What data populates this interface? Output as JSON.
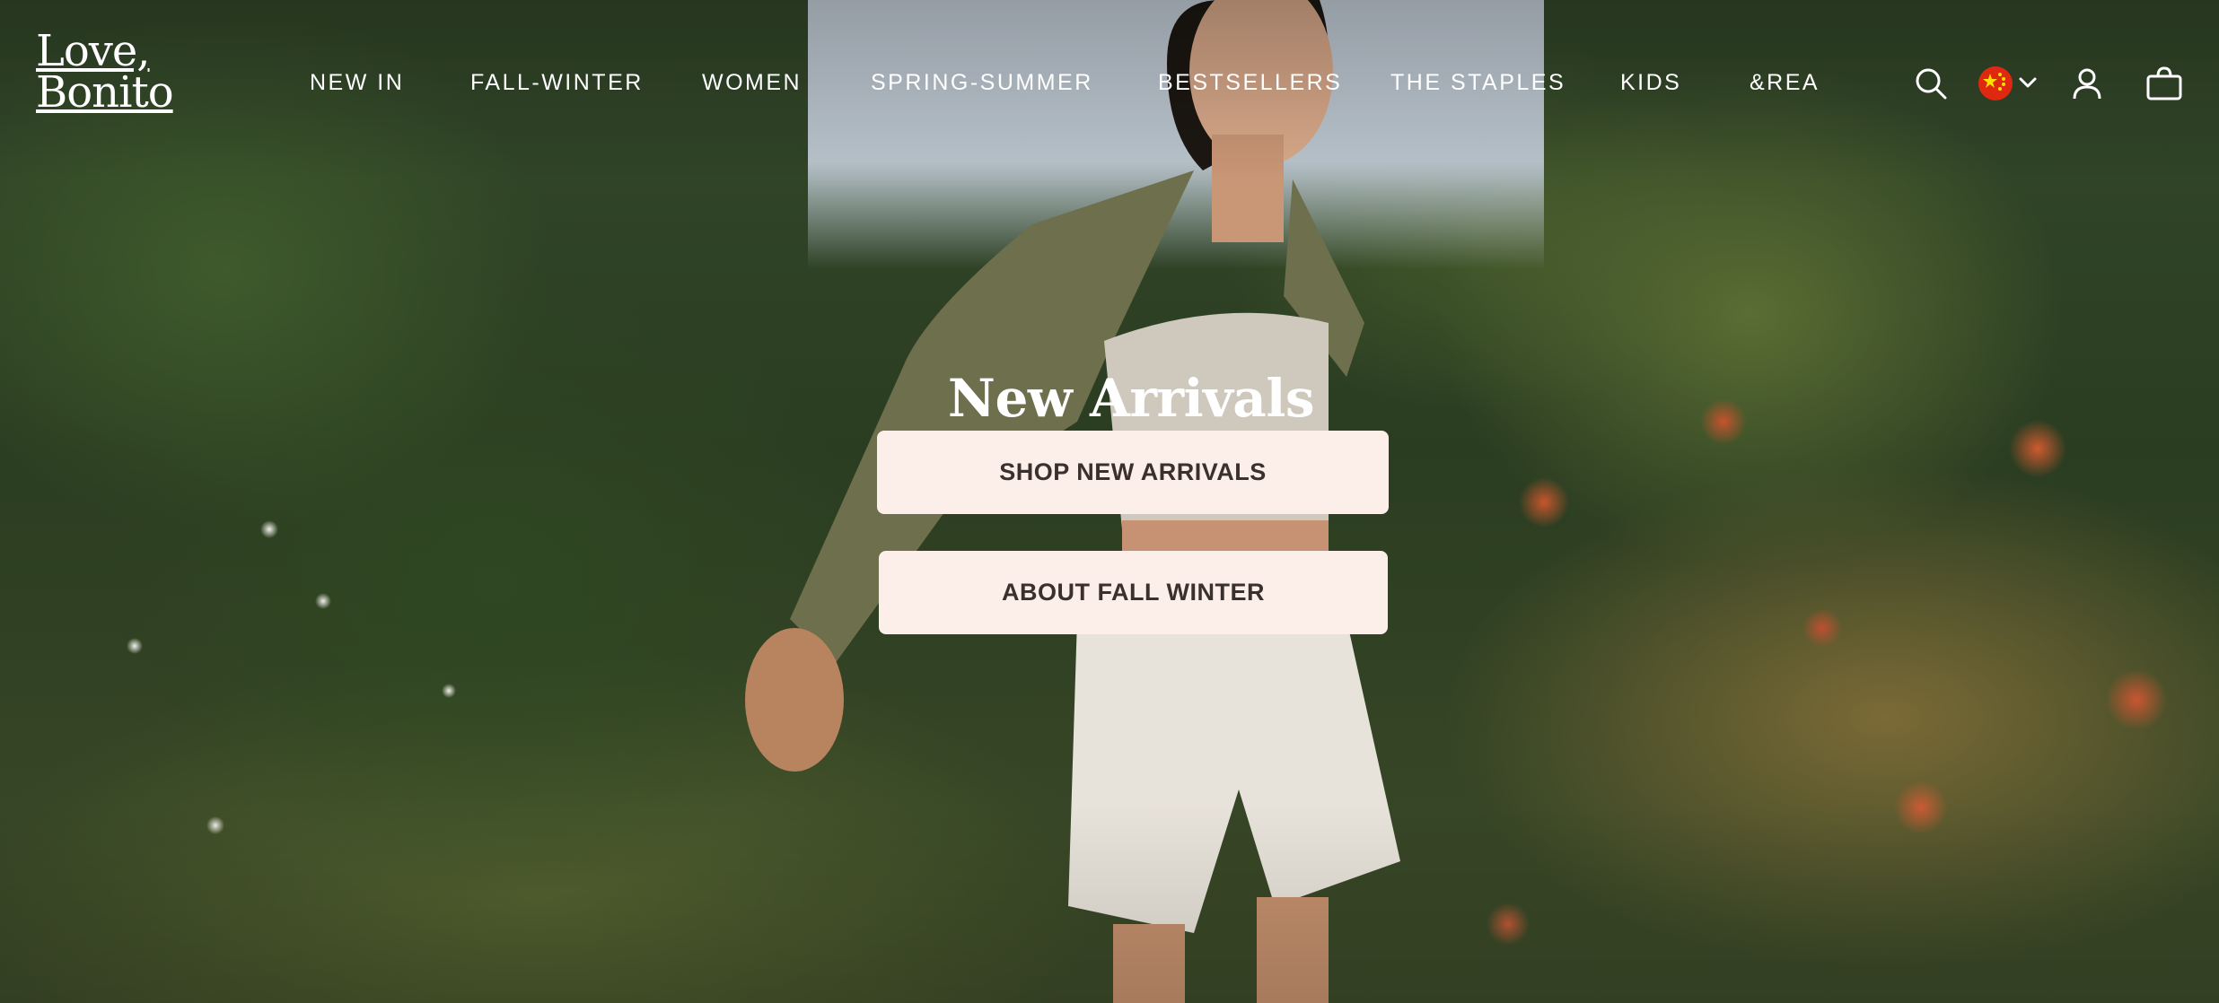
{
  "brand": {
    "logo_line1": "Love,",
    "logo_line2": "Bonito"
  },
  "nav": {
    "items": [
      {
        "label": "NEW IN"
      },
      {
        "label": "FALL-WINTER"
      },
      {
        "label": "WOMEN"
      },
      {
        "label": "SPRING-SUMMER"
      },
      {
        "label": "BESTSELLERS"
      },
      {
        "label": "THE STAPLES"
      },
      {
        "label": "KIDS"
      },
      {
        "label": "&REA"
      }
    ]
  },
  "header_icons": {
    "search": "search-icon",
    "region": "china-flag-icon",
    "region_dropdown": "chevron-down-icon",
    "account": "user-icon",
    "cart": "shopping-bag-icon"
  },
  "hero": {
    "headline": "New Arrivals",
    "cta_primary": "SHOP NEW ARRIVALS",
    "cta_secondary": "ABOUT FALL WINTER"
  },
  "colors": {
    "nav_text": "#ffffff",
    "cta_background": "#fcefe9",
    "cta_text": "#3a302d",
    "flag_red": "#de2910",
    "flag_yellow": "#ffde00"
  }
}
